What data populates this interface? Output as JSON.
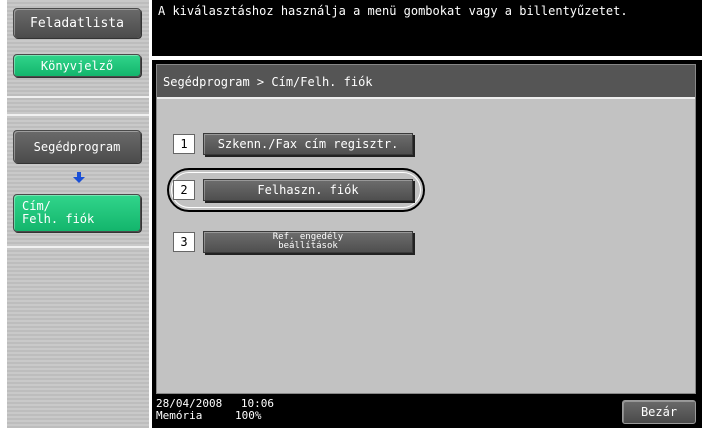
{
  "sidebar": {
    "job_list_label": "Feladatlista",
    "bookmark_label": "Könyvjelző",
    "utility_label": "Segédprogram",
    "current_label_line1": "Cím/",
    "current_label_line2": "Felh. fiók"
  },
  "header": {
    "message": "A kiválasztáshoz használja a menü gombokat vagy a billentyűzetet."
  },
  "main": {
    "breadcrumb": "Segédprogram > Cím/Felh. fiók",
    "items": [
      {
        "number": "1",
        "label": "Szkenn./Fax cím regisztr."
      },
      {
        "number": "2",
        "label": "Felhaszn. fiók"
      },
      {
        "number": "3",
        "label_line1": "Ref. engedély",
        "label_line2": "beállítások"
      }
    ]
  },
  "status": {
    "date": "28/04/2008",
    "time": "10:06",
    "memory_label": "Memória",
    "memory_value": "100%"
  },
  "footer": {
    "close_label": "Bezár"
  },
  "colors": {
    "accent_green": "#1fc47a",
    "panel_gray": "#c2c2c2",
    "button_gray": "#5c5c5c"
  }
}
